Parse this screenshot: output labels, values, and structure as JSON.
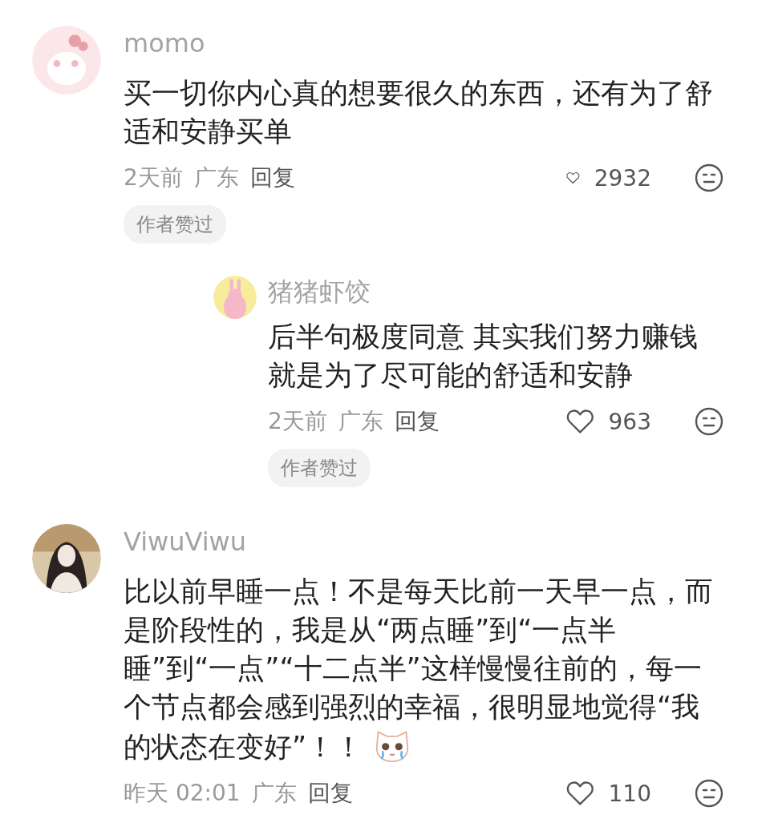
{
  "comments": [
    {
      "username": "momo",
      "text": "买一切你内心真的想要很久的东西，还有为了舒适和安静买单",
      "time": "2天前",
      "location": "广东",
      "reply_label": "回复",
      "likes": "2932",
      "author_liked": true,
      "author_liked_label": "作者赞过",
      "replies": [
        {
          "username": "猪猪虾饺",
          "text": "后半句极度同意 其实我们努力赚钱就是为了尽可能的舒适和安静",
          "time": "2天前",
          "location": "广东",
          "reply_label": "回复",
          "likes": "963",
          "author_liked": true,
          "author_liked_label": "作者赞过"
        }
      ]
    },
    {
      "username": "ViwuViwu",
      "text": "比以前早睡一点！不是每天比前一天早一点，而是阶段性的，我是从“两点睡”到“一点半睡”到“一点”“十二点半”这样慢慢往前的，每一个节点都会感到强烈的幸福，很明显地觉得“我的状态在变好”！！",
      "time": "昨天 02:01",
      "location": "广东",
      "reply_label": "回复",
      "likes": "110",
      "sticker": true
    }
  ]
}
